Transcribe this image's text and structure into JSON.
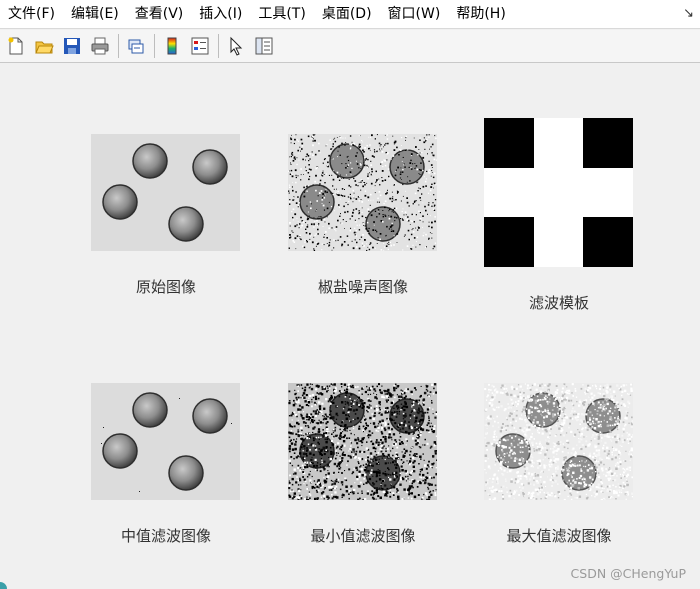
{
  "menu": {
    "items": [
      "文件(F)",
      "编辑(E)",
      "查看(V)",
      "插入(I)",
      "工具(T)",
      "桌面(D)",
      "窗口(W)",
      "帮助(H)"
    ],
    "arrow": "↘"
  },
  "toolbar": {
    "buttons": [
      "new-figure-icon",
      "open-file-icon",
      "save-icon",
      "print-icon",
      "link-figure-icon",
      "insert-colorbar-icon",
      "insert-legend-icon",
      "edit-plot-pointer-icon",
      "property-inspector-icon"
    ]
  },
  "panels": {
    "original": "原始图像",
    "salt_pepper": "椒盐噪声图像",
    "filter_template": "滤波模板",
    "median": "中值滤波图像",
    "min": "最小值滤波图像",
    "max": "最大值滤波图像"
  },
  "watermark": "CSDN @CHengYuP",
  "colors": {
    "background": "#f0f0f0",
    "menubar": "#ffffff",
    "toolbar": "#f5f5f5"
  }
}
